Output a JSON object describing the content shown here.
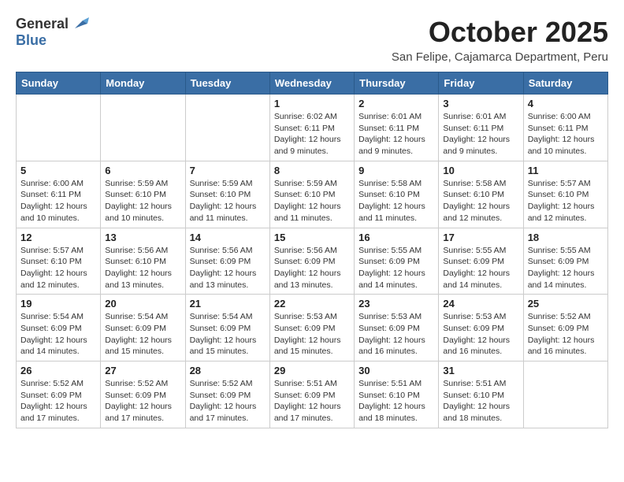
{
  "logo": {
    "general": "General",
    "blue": "Blue"
  },
  "header": {
    "month": "October 2025",
    "subtitle": "San Felipe, Cajamarca Department, Peru"
  },
  "days_of_week": [
    "Sunday",
    "Monday",
    "Tuesday",
    "Wednesday",
    "Thursday",
    "Friday",
    "Saturday"
  ],
  "weeks": [
    [
      {
        "day": "",
        "info": ""
      },
      {
        "day": "",
        "info": ""
      },
      {
        "day": "",
        "info": ""
      },
      {
        "day": "1",
        "info": "Sunrise: 6:02 AM\nSunset: 6:11 PM\nDaylight: 12 hours\nand 9 minutes."
      },
      {
        "day": "2",
        "info": "Sunrise: 6:01 AM\nSunset: 6:11 PM\nDaylight: 12 hours\nand 9 minutes."
      },
      {
        "day": "3",
        "info": "Sunrise: 6:01 AM\nSunset: 6:11 PM\nDaylight: 12 hours\nand 9 minutes."
      },
      {
        "day": "4",
        "info": "Sunrise: 6:00 AM\nSunset: 6:11 PM\nDaylight: 12 hours\nand 10 minutes."
      }
    ],
    [
      {
        "day": "5",
        "info": "Sunrise: 6:00 AM\nSunset: 6:11 PM\nDaylight: 12 hours\nand 10 minutes."
      },
      {
        "day": "6",
        "info": "Sunrise: 5:59 AM\nSunset: 6:10 PM\nDaylight: 12 hours\nand 10 minutes."
      },
      {
        "day": "7",
        "info": "Sunrise: 5:59 AM\nSunset: 6:10 PM\nDaylight: 12 hours\nand 11 minutes."
      },
      {
        "day": "8",
        "info": "Sunrise: 5:59 AM\nSunset: 6:10 PM\nDaylight: 12 hours\nand 11 minutes."
      },
      {
        "day": "9",
        "info": "Sunrise: 5:58 AM\nSunset: 6:10 PM\nDaylight: 12 hours\nand 11 minutes."
      },
      {
        "day": "10",
        "info": "Sunrise: 5:58 AM\nSunset: 6:10 PM\nDaylight: 12 hours\nand 12 minutes."
      },
      {
        "day": "11",
        "info": "Sunrise: 5:57 AM\nSunset: 6:10 PM\nDaylight: 12 hours\nand 12 minutes."
      }
    ],
    [
      {
        "day": "12",
        "info": "Sunrise: 5:57 AM\nSunset: 6:10 PM\nDaylight: 12 hours\nand 12 minutes."
      },
      {
        "day": "13",
        "info": "Sunrise: 5:56 AM\nSunset: 6:10 PM\nDaylight: 12 hours\nand 13 minutes."
      },
      {
        "day": "14",
        "info": "Sunrise: 5:56 AM\nSunset: 6:09 PM\nDaylight: 12 hours\nand 13 minutes."
      },
      {
        "day": "15",
        "info": "Sunrise: 5:56 AM\nSunset: 6:09 PM\nDaylight: 12 hours\nand 13 minutes."
      },
      {
        "day": "16",
        "info": "Sunrise: 5:55 AM\nSunset: 6:09 PM\nDaylight: 12 hours\nand 14 minutes."
      },
      {
        "day": "17",
        "info": "Sunrise: 5:55 AM\nSunset: 6:09 PM\nDaylight: 12 hours\nand 14 minutes."
      },
      {
        "day": "18",
        "info": "Sunrise: 5:55 AM\nSunset: 6:09 PM\nDaylight: 12 hours\nand 14 minutes."
      }
    ],
    [
      {
        "day": "19",
        "info": "Sunrise: 5:54 AM\nSunset: 6:09 PM\nDaylight: 12 hours\nand 14 minutes."
      },
      {
        "day": "20",
        "info": "Sunrise: 5:54 AM\nSunset: 6:09 PM\nDaylight: 12 hours\nand 15 minutes."
      },
      {
        "day": "21",
        "info": "Sunrise: 5:54 AM\nSunset: 6:09 PM\nDaylight: 12 hours\nand 15 minutes."
      },
      {
        "day": "22",
        "info": "Sunrise: 5:53 AM\nSunset: 6:09 PM\nDaylight: 12 hours\nand 15 minutes."
      },
      {
        "day": "23",
        "info": "Sunrise: 5:53 AM\nSunset: 6:09 PM\nDaylight: 12 hours\nand 16 minutes."
      },
      {
        "day": "24",
        "info": "Sunrise: 5:53 AM\nSunset: 6:09 PM\nDaylight: 12 hours\nand 16 minutes."
      },
      {
        "day": "25",
        "info": "Sunrise: 5:52 AM\nSunset: 6:09 PM\nDaylight: 12 hours\nand 16 minutes."
      }
    ],
    [
      {
        "day": "26",
        "info": "Sunrise: 5:52 AM\nSunset: 6:09 PM\nDaylight: 12 hours\nand 17 minutes."
      },
      {
        "day": "27",
        "info": "Sunrise: 5:52 AM\nSunset: 6:09 PM\nDaylight: 12 hours\nand 17 minutes."
      },
      {
        "day": "28",
        "info": "Sunrise: 5:52 AM\nSunset: 6:09 PM\nDaylight: 12 hours\nand 17 minutes."
      },
      {
        "day": "29",
        "info": "Sunrise: 5:51 AM\nSunset: 6:09 PM\nDaylight: 12 hours\nand 17 minutes."
      },
      {
        "day": "30",
        "info": "Sunrise: 5:51 AM\nSunset: 6:10 PM\nDaylight: 12 hours\nand 18 minutes."
      },
      {
        "day": "31",
        "info": "Sunrise: 5:51 AM\nSunset: 6:10 PM\nDaylight: 12 hours\nand 18 minutes."
      },
      {
        "day": "",
        "info": ""
      }
    ]
  ]
}
